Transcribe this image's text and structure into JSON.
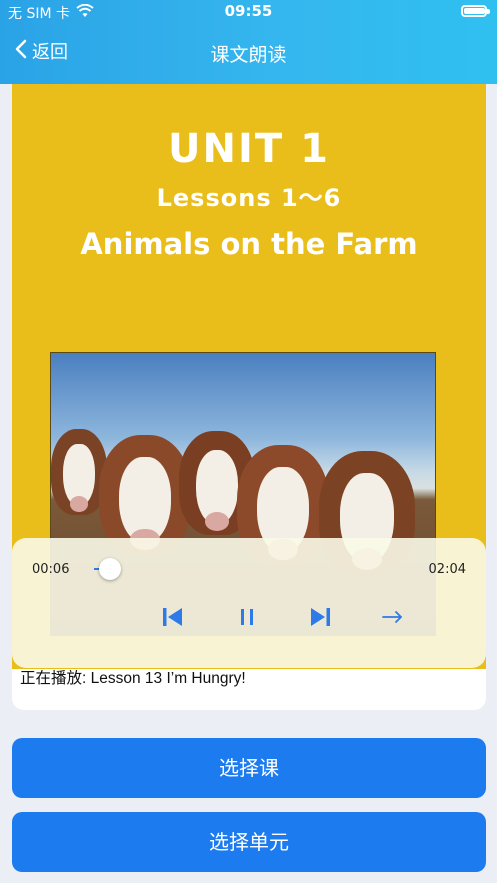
{
  "status_bar": {
    "carrier": "无 SIM 卡",
    "time": "09:55",
    "battery_level": 1.0
  },
  "nav": {
    "back_label": "返回",
    "title": "课文朗读"
  },
  "cover": {
    "unit": "UNIT 1",
    "lessons": "Lessons 1～6",
    "topic": "Animals on the Farm",
    "photo_subject": "herd of cattle"
  },
  "player": {
    "current_time": "00:06",
    "duration": "02:04",
    "progress_fraction": 0.05,
    "controls": [
      "previous-icon",
      "pause-icon",
      "next-icon",
      "arrow-right-icon"
    ]
  },
  "now_playing": "正在播放: Lesson 13 I’m Hungry!",
  "buttons": {
    "select_lesson": "选择课",
    "select_unit": "选择单元"
  },
  "colors": {
    "header": "#2fb0ea",
    "accent": "#1d7bf0",
    "cover_bg": "#e9bd1a"
  }
}
